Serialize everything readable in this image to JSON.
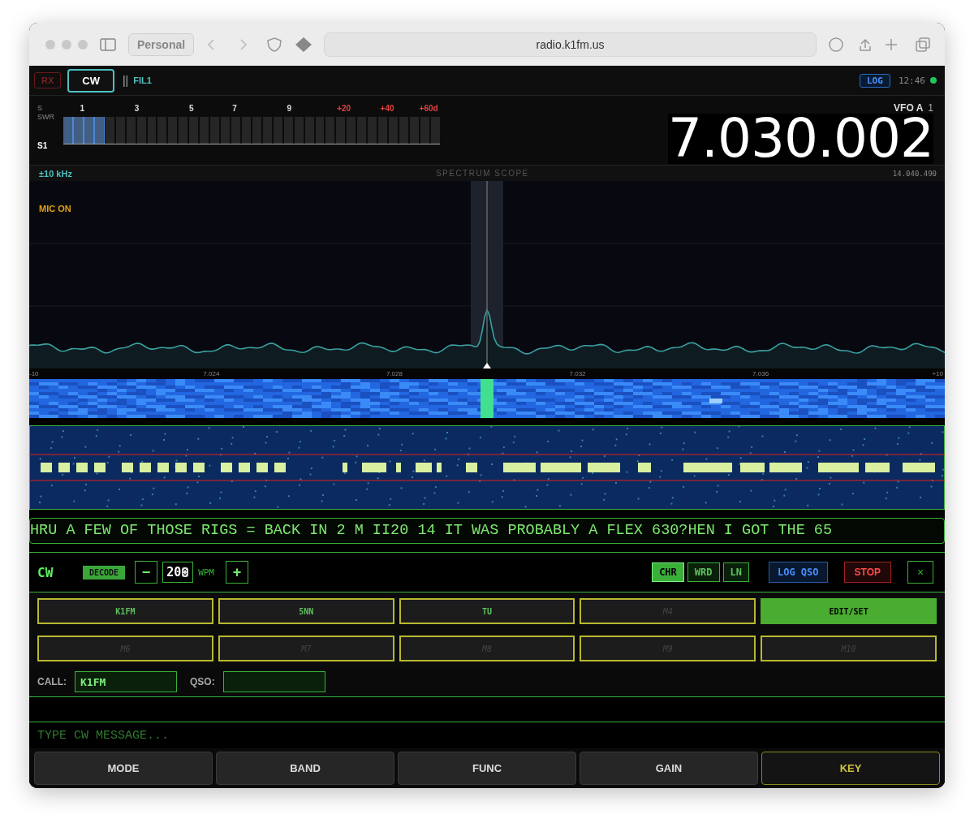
{
  "browser": {
    "profile": "Personal",
    "url": "radio.k1fm.us"
  },
  "top_bar": {
    "rx": {
      "label": "RX",
      "on": false
    },
    "mode": {
      "label": "CW",
      "selected": true
    },
    "filter_bars": "||",
    "filter": "FIL1",
    "log": "LOG",
    "time": "12:46",
    "status": {
      "color": "#22c55e"
    }
  },
  "meter": {
    "s_label": "S",
    "swr_label": "SWR",
    "reading": "S1",
    "level": 0.11,
    "scale": [
      {
        "label": "1",
        "kind": "normal"
      },
      {
        "label": "3",
        "kind": "normal"
      },
      {
        "label": "5",
        "kind": "normal"
      },
      {
        "label": "7",
        "kind": "normal"
      },
      {
        "label": "9",
        "kind": "normal"
      },
      {
        "label": "+20",
        "kind": "over"
      },
      {
        "label": "+40",
        "kind": "over"
      },
      {
        "label": "+60d",
        "kind": "over"
      }
    ]
  },
  "vfo": {
    "label": "VFO A",
    "number": "1",
    "frequency": "7.030.002"
  },
  "scope": {
    "span": "±10 kHz",
    "title": "SPECTRUM SCOPE",
    "frequency": "14.040.490",
    "mic": "MIC ON",
    "axis_labels": [
      "-10",
      "7.024",
      "7.028",
      "7.032",
      "7.036",
      "+10"
    ]
  },
  "decoded_text": "HRU A FEW OF THOSE RIGS = BACK IN 2 M II20 14 IT WAS PROBABLY A FLEX 630?HEN I GOT THE 65",
  "cw_panel": {
    "title": "CW",
    "decode": {
      "label": "DECODE",
      "on": true
    },
    "minus": "−",
    "wpm": "20",
    "wpm_unit": "WPM",
    "plus": "+",
    "modes": [
      {
        "label": "CHR",
        "selected": true
      },
      {
        "label": "WRD",
        "selected": false
      },
      {
        "label": "LN",
        "selected": false
      }
    ],
    "log_qso": "LOG QSO",
    "stop": "STOP",
    "close": "×"
  },
  "macros": [
    {
      "label": "K1FM",
      "kind": "set"
    },
    {
      "label": "5NN",
      "kind": "set"
    },
    {
      "label": "TU",
      "kind": "set"
    },
    {
      "label": "M4",
      "kind": "empty"
    },
    {
      "label": "EDIT/SET",
      "kind": "edit"
    },
    {
      "label": "M6",
      "kind": "empty"
    },
    {
      "label": "M7",
      "kind": "empty"
    },
    {
      "label": "M8",
      "kind": "empty"
    },
    {
      "label": "M9",
      "kind": "empty"
    },
    {
      "label": "M10",
      "kind": "empty"
    }
  ],
  "call": {
    "label": "CALL:",
    "value": "K1FM"
  },
  "qso": {
    "label": "QSO:"
  },
  "message": {
    "placeholder": "TYPE CW MESSAGE..."
  },
  "bottom_buttons": [
    {
      "label": "MODE",
      "selected": false
    },
    {
      "label": "BAND",
      "selected": false
    },
    {
      "label": "FUNC",
      "selected": false
    },
    {
      "label": "GAIN",
      "selected": false
    },
    {
      "label": "KEY",
      "selected": true
    }
  ]
}
